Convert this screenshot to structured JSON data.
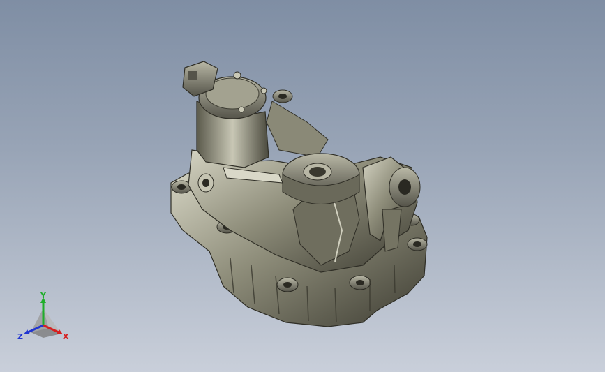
{
  "viewport": {
    "background_top": "#7f8ea4",
    "background_bottom": "#c9cfda",
    "model_color": "#8e8d7a",
    "model_shadow": "#3e3d33",
    "model_highlight": "#d9d8c8"
  },
  "triad": {
    "x_label": "X",
    "y_label": "Y",
    "z_label": "Z",
    "x_color": "#d62020",
    "y_color": "#1fae2a",
    "z_color": "#2136d1"
  }
}
